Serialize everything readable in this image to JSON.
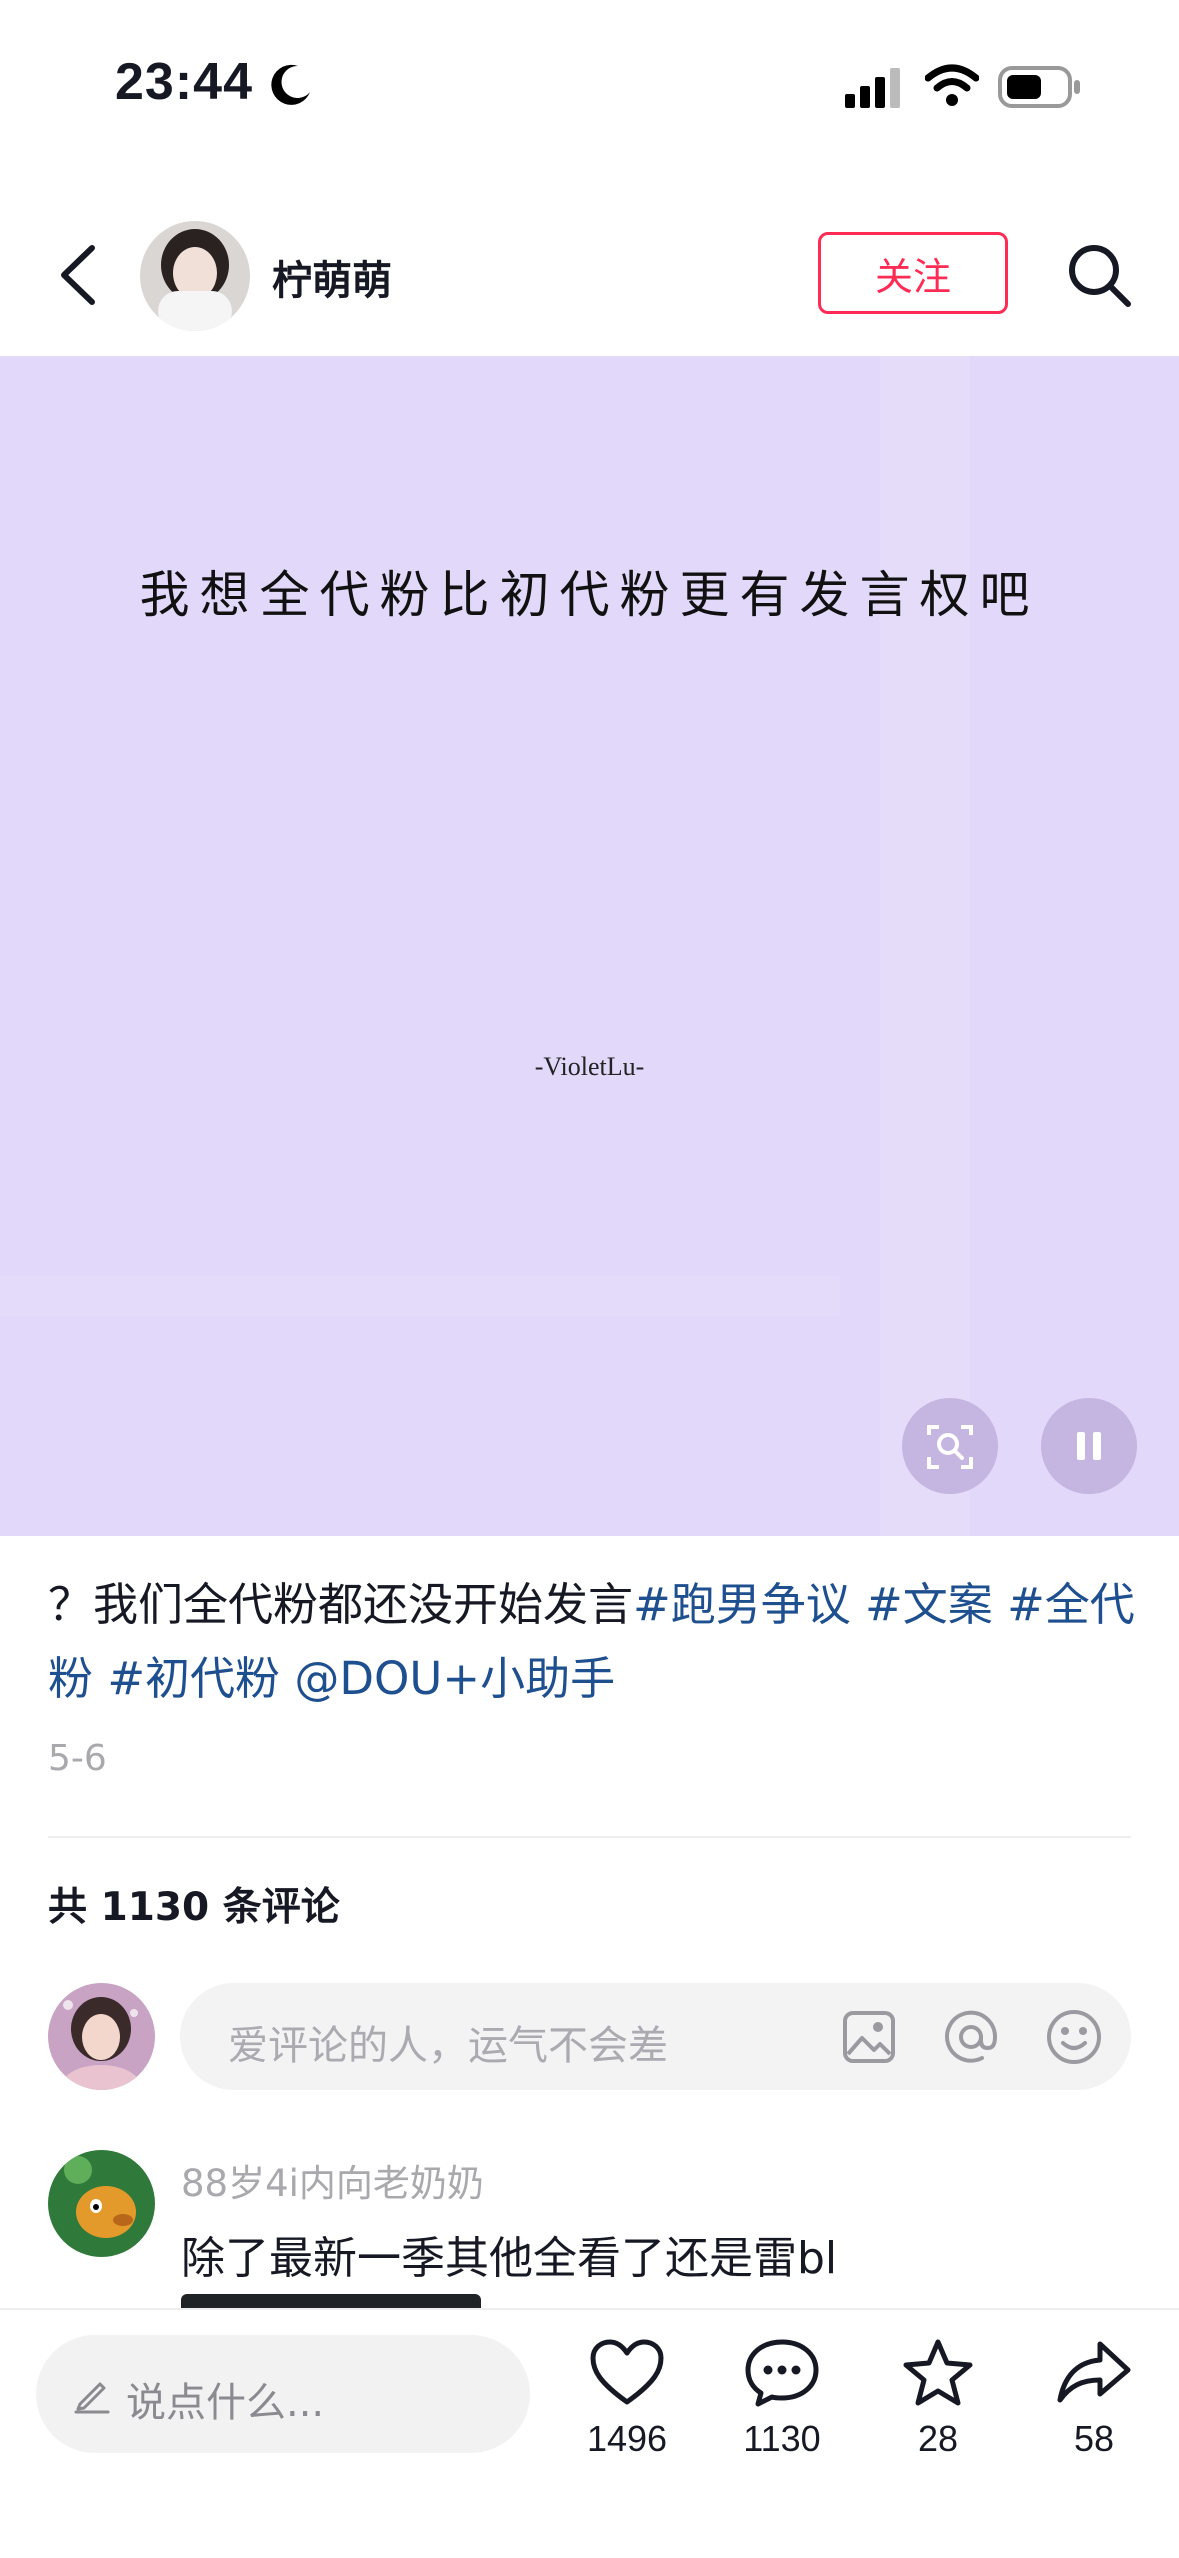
{
  "status_bar": {
    "time": "23:44"
  },
  "header": {
    "username": "柠萌萌",
    "follow_label": "关注"
  },
  "video": {
    "caption": "我想全代粉比初代粉更有发言权吧",
    "credit": "-VioletLu-"
  },
  "description": {
    "text": "？我们全代粉都还没开始发言",
    "tags": [
      "#跑男争议",
      "#文案",
      "#全代粉",
      "#初代粉",
      "@DOU+小助手"
    ]
  },
  "date": "5-6",
  "comments": {
    "count_label": "共 1130 条评论",
    "input_placeholder": "爱评论的人，运气不会差",
    "items": [
      {
        "user": "88岁4i内向老奶奶",
        "text": "除了最新一季其他全看了还是雷bl"
      }
    ]
  },
  "bottom_bar": {
    "placeholder": "说点什么...",
    "likes": "1496",
    "comments": "1130",
    "favorites": "28",
    "shares": "58"
  },
  "icons": [
    "moon-icon",
    "signal-icon",
    "wifi-icon",
    "battery-icon",
    "back-icon",
    "search-icon",
    "image-icon",
    "at-icon",
    "emoji-icon",
    "pencil-icon",
    "heart-icon",
    "comment-icon",
    "star-icon",
    "share-icon",
    "lens-icon",
    "pause-icon"
  ],
  "colors": {
    "accent": "#fe2c55",
    "video_bg": "#e2d8fa",
    "hashtag": "#1e4f8f"
  }
}
